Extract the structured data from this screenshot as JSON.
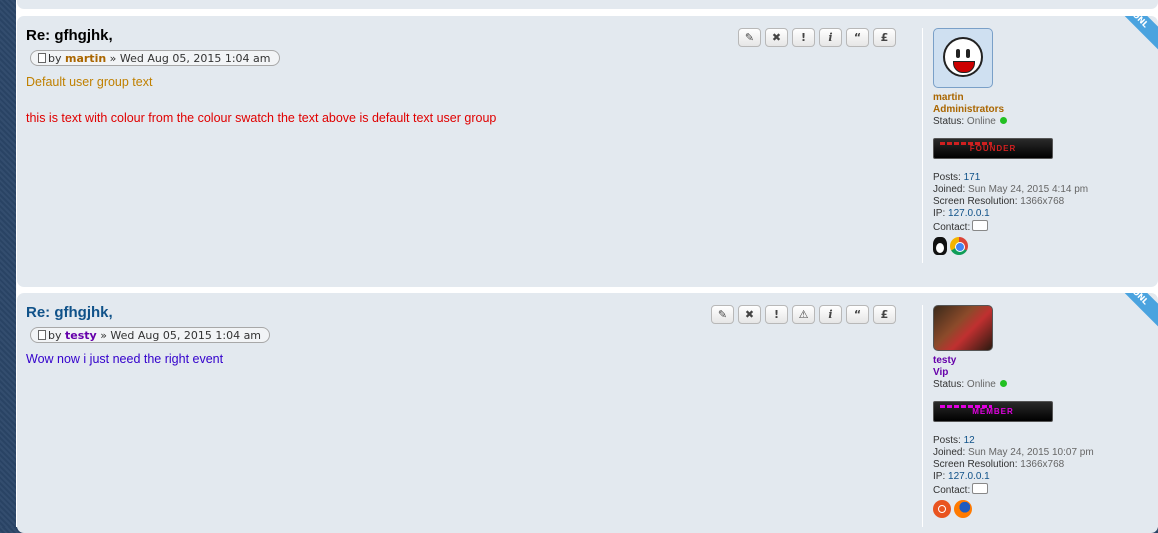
{
  "posts": [
    {
      "title": "Re: gfhgjhk,",
      "by": "by",
      "author": "martin",
      "date": "» Wed Aug 05, 2015 1:04 am",
      "lines": [
        "Default user group text",
        "this is text with colour from the colour swatch the text above is default text user group"
      ],
      "buttons": [
        "✎",
        "✖",
        "!",
        "i",
        "“",
        "£"
      ],
      "ribbon": "ONL",
      "profile": {
        "name": "martin",
        "rank": "Administrators",
        "status_label": "Status:",
        "status_value": "Online",
        "rank_image_text": "FOUNDER",
        "posts_label": "Posts:",
        "posts": "171",
        "joined_label": "Joined:",
        "joined": "Sun May 24, 2015 4:14 pm",
        "resolution_label": "Screen Resolution:",
        "resolution": "1366x768",
        "ip_label": "IP:",
        "ip": "127.0.0.1",
        "contact_label": "Contact:",
        "os_icons": [
          "linux-icon",
          "chrome-icon"
        ]
      }
    },
    {
      "title": "Re: gfhgjhk,",
      "by": "by",
      "author": "testy",
      "date": "» Wed Aug 05, 2015 1:04 am",
      "lines": [
        "Wow now i just need the right event"
      ],
      "buttons": [
        "✎",
        "✖",
        "!",
        "⚠",
        "i",
        "“",
        "£"
      ],
      "ribbon": "ONL",
      "profile": {
        "name": "testy",
        "rank": "Vip",
        "status_label": "Status:",
        "status_value": "Online",
        "rank_image_text": "MEMBER",
        "posts_label": "Posts:",
        "posts": "12",
        "joined_label": "Joined:",
        "joined": "Sun May 24, 2015 10:07 pm",
        "resolution_label": "Screen Resolution:",
        "resolution": "1366x768",
        "ip_label": "IP:",
        "ip": "127.0.0.1",
        "contact_label": "Contact:",
        "os_icons": [
          "ubuntu-icon",
          "firefox-icon"
        ]
      }
    }
  ]
}
